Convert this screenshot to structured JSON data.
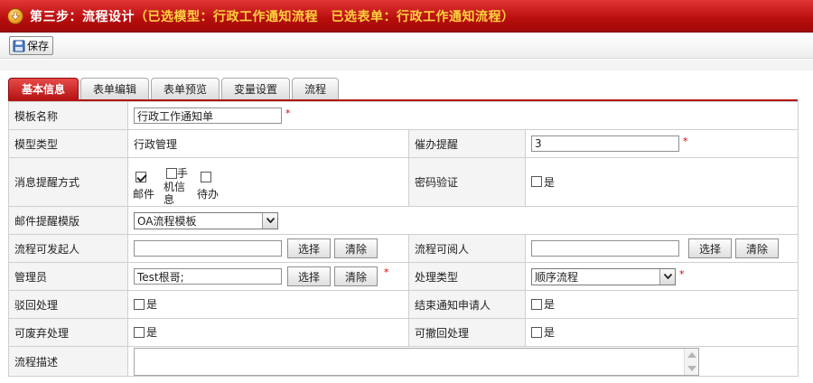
{
  "header": {
    "title": "第三步：流程设计",
    "subtitle": "（已选模型：行政工作通知流程　已选表单：行政工作通知流程）"
  },
  "toolbar": {
    "save_label": "保存"
  },
  "tabs": [
    {
      "label": "基本信息",
      "active": true
    },
    {
      "label": "表单编辑",
      "active": false
    },
    {
      "label": "表单预览",
      "active": false
    },
    {
      "label": "变量设置",
      "active": false
    },
    {
      "label": "流程",
      "active": false
    }
  ],
  "form": {
    "template_name": {
      "label": "模板名称",
      "value": "行政工作通知单"
    },
    "model_type": {
      "label": "模型类型",
      "value": "行政管理"
    },
    "reminder": {
      "label": "催办提醒",
      "value": "3"
    },
    "notify": {
      "label": "消息提醒方式",
      "email": {
        "label": "邮件",
        "checked": true
      },
      "sms": {
        "label_line1": "手",
        "label_line2": "机信",
        "label_line3": "息",
        "checked": false
      },
      "todo": {
        "label": "待办",
        "checked": false
      }
    },
    "password_verify": {
      "label": "密码验证",
      "option": "是",
      "checked": false
    },
    "mail_template": {
      "label": "邮件提醒模版",
      "value": "OA流程模板"
    },
    "initiator": {
      "label": "流程可发起人",
      "value": ""
    },
    "reader": {
      "label": "流程可阅人",
      "value": ""
    },
    "admin": {
      "label": "管理员",
      "value": "Test根哥;"
    },
    "process_type": {
      "label": "处理类型",
      "value": "顺序流程"
    },
    "reject": {
      "label": "驳回处理",
      "option": "是",
      "checked": false
    },
    "end_notify": {
      "label": "结束通知申请人",
      "option": "是",
      "checked": false
    },
    "abandon": {
      "label": "可废弃处理",
      "option": "是",
      "checked": false
    },
    "revoke": {
      "label": "可撤回处理",
      "option": "是",
      "checked": false
    },
    "description": {
      "label": "流程描述",
      "value": ""
    }
  },
  "buttons": {
    "select": "选择",
    "clear": "清除"
  },
  "required_mark": "*",
  "colors": {
    "header_red": "#b80d0d",
    "subtitle_yellow": "#ffd23f",
    "required_red": "#dd0000"
  }
}
